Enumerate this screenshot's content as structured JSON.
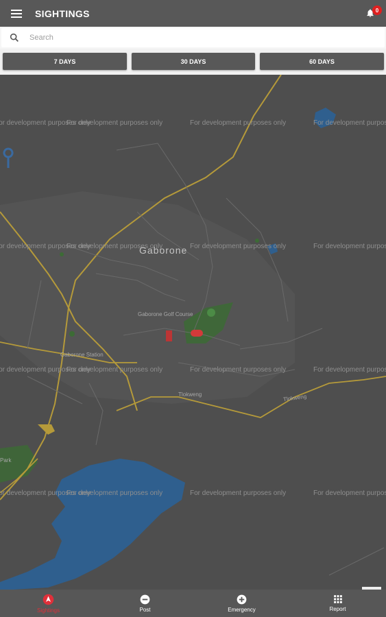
{
  "app_bar": {
    "title": "SIGHTINGS",
    "notification_count": "0"
  },
  "search": {
    "placeholder": "Search"
  },
  "filters": [
    {
      "label": "7 DAYS"
    },
    {
      "label": "30 DAYS"
    },
    {
      "label": "60 DAYS"
    }
  ],
  "map": {
    "watermark": "For development purposes only",
    "city_label": "Gaborone",
    "labels": {
      "golf_course": "Gaborone Golf Course",
      "station": "Gaborone Station",
      "park": "Park",
      "tlokweng_road": "Tlokweng",
      "tlokweng_road_2": "Tlokweng"
    }
  },
  "bottom_nav": [
    {
      "label": "Sightings",
      "icon": "navigation-arrow-icon",
      "active": true
    },
    {
      "label": "Post",
      "icon": "minus-circle-icon"
    },
    {
      "label": "Emergency",
      "icon": "plus-circle-icon"
    },
    {
      "label": "Report",
      "icon": "grid-icon"
    }
  ],
  "colors": {
    "accent": "#e02020",
    "appbar": "#585858",
    "water": "#2f5f8e",
    "road": "#b59a3a",
    "green": "#3c6b35"
  }
}
